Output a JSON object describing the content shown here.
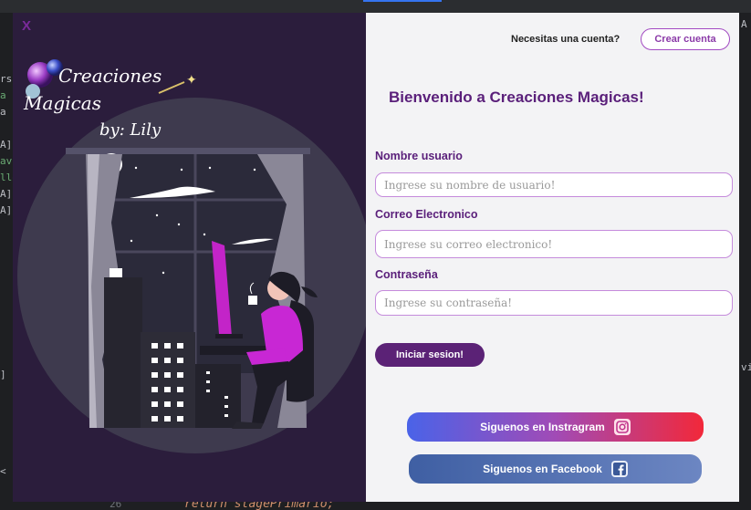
{
  "window": {
    "close_label": "X"
  },
  "logo": {
    "line1": "Creaciones",
    "line2": "Magicas",
    "line3": "by: Lily"
  },
  "header": {
    "prompt": "Necesitas una cuenta?",
    "create_account_label": "Crear cuenta"
  },
  "form": {
    "welcome_title": "Bienvenido a Creaciones Magicas!",
    "username_label": "Nombre usuario",
    "username_placeholder": "Ingrese su nombre de usuario!",
    "email_label": "Correo Electronico",
    "email_placeholder": "Ingrese su correo electronico!",
    "password_label": "Contraseña",
    "password_placeholder": "Ingrese su contraseña!",
    "login_label": "Iniciar sesion!"
  },
  "social": {
    "instagram_label": "Siguenos en Instragram",
    "facebook_label": "Siguenos en Facebook"
  },
  "ide": {
    "line_number": "26",
    "code_line": "return stagePrimario;",
    "left_fragments": [
      "rs",
      "a [",
      "a [-",
      "A]",
      "ava",
      "llec",
      "A]",
      "A]",
      "]",
      "<"
    ],
    "right_fragments": [
      "A",
      "vi"
    ]
  },
  "colors": {
    "accent": "#5a1f7a",
    "panel_dark": "#2b1d3c",
    "instagram_start": "#4a63e8",
    "instagram_end": "#f2283a",
    "facebook": "#4a6aa8"
  }
}
